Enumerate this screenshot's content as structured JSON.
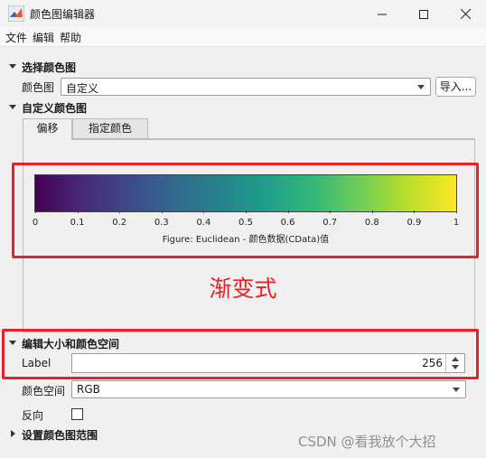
{
  "window": {
    "title": "颜色图编辑器",
    "minimize_icon": "minimize-icon",
    "maximize_icon": "maximize-icon",
    "close_icon": "close-icon",
    "app_icon": "matlab-icon"
  },
  "menu": [
    "文件",
    "编辑",
    "帮助"
  ],
  "select_colormap": {
    "title": "选择颜色图",
    "label": "颜色图",
    "value": "自定义",
    "import_button": "导入..."
  },
  "custom_colormap": {
    "title": "自定义颜色图",
    "tabs": [
      "偏移",
      "指定颜色"
    ],
    "active_tab": 0,
    "colorbar": {
      "colormap": "viridis",
      "ticks": [
        "0",
        "0.1",
        "0.2",
        "0.3",
        "0.4",
        "0.5",
        "0.6",
        "0.7",
        "0.8",
        "0.9",
        "1"
      ],
      "caption": "Figure: Euclidean - 颜色数据(CData)值"
    },
    "annotation": "渐变式"
  },
  "size_colorspace": {
    "title": "编辑大小和颜色空间",
    "size_label": "Label",
    "size_value": "256",
    "colorspace_label": "颜色空间",
    "colorspace_value": "RGB",
    "reverse_label": "反向",
    "reverse_checked": false
  },
  "colormap_range": {
    "title": "设置颜色图范围"
  },
  "watermark": "CSDN @看我放个大招",
  "colors": {
    "highlight": "#e8202a",
    "background": "#f0f0f0"
  }
}
